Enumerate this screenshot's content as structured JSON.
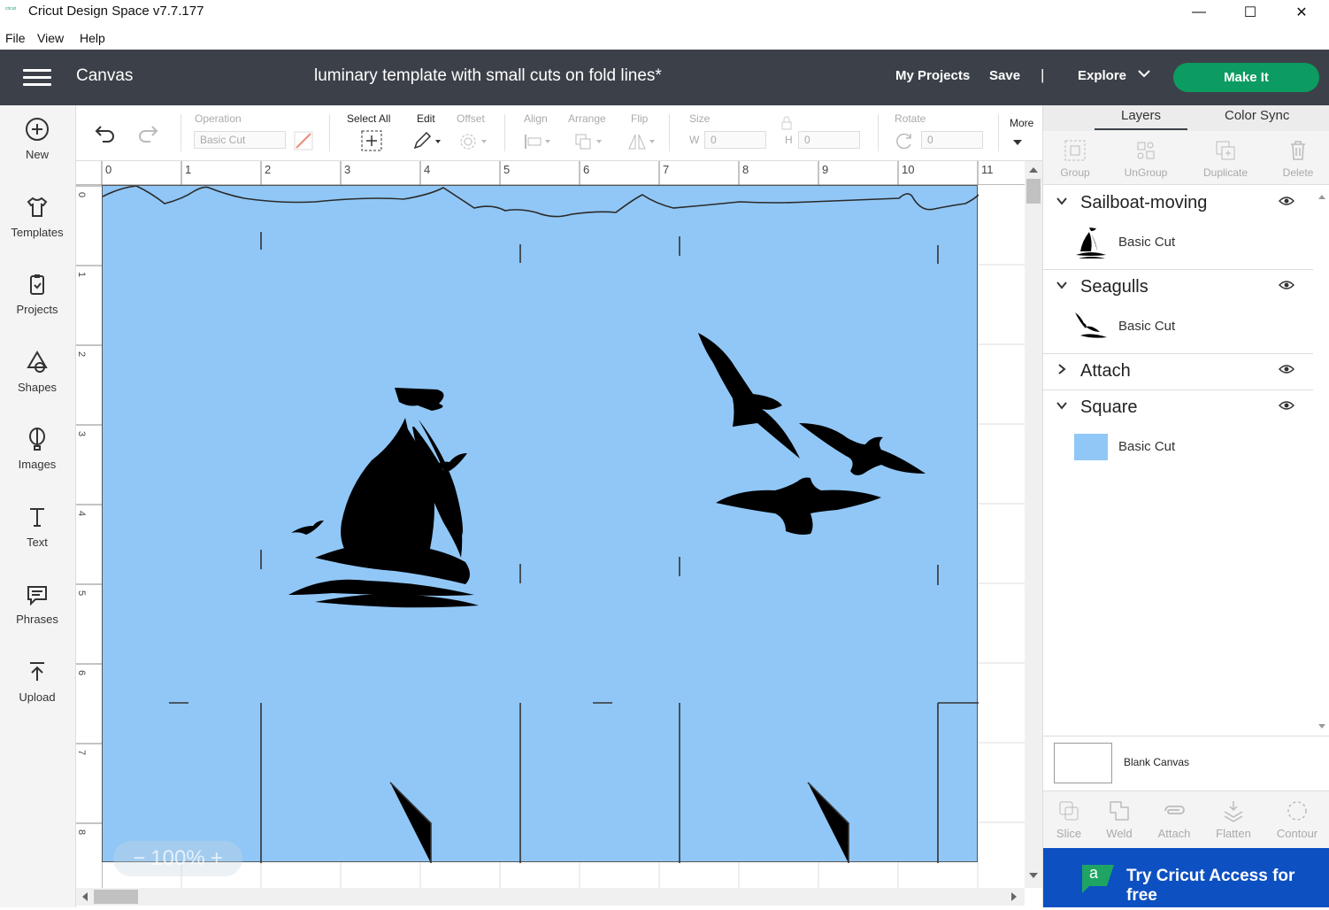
{
  "window": {
    "logo_text": "cricut",
    "title": "Cricut Design Space  v7.7.177",
    "min": "—",
    "max": "☐",
    "close": "✕"
  },
  "menu": [
    "File",
    "View",
    "Help"
  ],
  "appbar": {
    "section": "Canvas",
    "project_title": "luminary template with small cuts on fold lines*",
    "my_projects": "My Projects",
    "save": "Save",
    "separator": "|",
    "explore": "Explore",
    "make_it": "Make It"
  },
  "sidebar": {
    "items": [
      {
        "label": "New",
        "icon": "plus-circle-icon"
      },
      {
        "label": "Templates",
        "icon": "tshirt-icon"
      },
      {
        "label": "Projects",
        "icon": "clipboard-icon"
      },
      {
        "label": "Shapes",
        "icon": "shapes-icon"
      },
      {
        "label": "Images",
        "icon": "balloon-icon"
      },
      {
        "label": "Text",
        "icon": "text-icon"
      },
      {
        "label": "Phrases",
        "icon": "speech-bubble-icon"
      },
      {
        "label": "Upload",
        "icon": "upload-icon"
      }
    ]
  },
  "toolbar": {
    "operation_label": "Operation",
    "operation_value": "Basic Cut",
    "select_all": "Select All",
    "edit": "Edit",
    "offset": "Offset",
    "align": "Align",
    "arrange": "Arrange",
    "flip": "Flip",
    "size": "Size",
    "w_label": "W",
    "w_value": "0",
    "h_label": "H",
    "h_value": "0",
    "rotate": "Rotate",
    "rotate_value": "0",
    "more": "More"
  },
  "ruler": {
    "top": [
      "0",
      "1",
      "2",
      "3",
      "4",
      "5",
      "6",
      "7",
      "8",
      "9",
      "10",
      "11"
    ],
    "left": [
      "0",
      "1",
      "2",
      "3",
      "4",
      "5",
      "6",
      "7",
      "8"
    ]
  },
  "canvas": {
    "sheet_color": "#91c7f6",
    "zoom": "100%",
    "zoom_minus": "−",
    "zoom_plus": "+"
  },
  "panel": {
    "tabs": [
      "Layers",
      "Color Sync"
    ],
    "tools": [
      "Group",
      "UnGroup",
      "Duplicate",
      "Delete"
    ],
    "layers": [
      {
        "name": "Sailboat-moving",
        "expanded": true,
        "item": "Basic Cut"
      },
      {
        "name": "Seagulls",
        "expanded": true,
        "item": "Basic Cut"
      },
      {
        "name": "Attach",
        "expanded": false,
        "item": ""
      },
      {
        "name": "Square",
        "expanded": true,
        "item": "Basic Cut"
      }
    ],
    "blank_canvas": "Blank Canvas",
    "bottom_tools": [
      "Slice",
      "Weld",
      "Attach",
      "Flatten",
      "Contour"
    ],
    "access_text": "Try Cricut Access for free",
    "access_logo": "a"
  }
}
